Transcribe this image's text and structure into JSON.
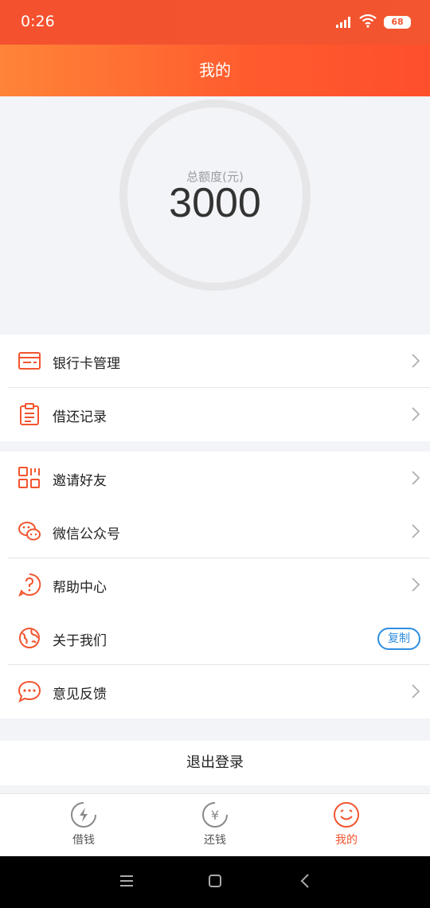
{
  "status": {
    "time": "0:26",
    "battery": "68"
  },
  "header": {
    "title": "我的"
  },
  "credit": {
    "label": "总额度(元)",
    "amount": "3000"
  },
  "menu_group1": [
    {
      "label": "银行卡管理",
      "icon": "bank-card-icon"
    },
    {
      "label": "借还记录",
      "icon": "clipboard-icon"
    }
  ],
  "menu_group2": [
    {
      "label": "邀请好友",
      "icon": "qrcode-icon"
    },
    {
      "label": "微信公众号",
      "icon": "wechat-icon"
    },
    {
      "label": "帮助中心",
      "icon": "help-icon"
    },
    {
      "label": "关于我们",
      "icon": "globe-icon",
      "action": "复制"
    },
    {
      "label": "意见反馈",
      "icon": "chat-icon"
    }
  ],
  "logout": {
    "label": "退出登录"
  },
  "tabs": [
    {
      "label": "借钱",
      "icon": "lightning-icon"
    },
    {
      "label": "还钱",
      "icon": "yen-icon"
    },
    {
      "label": "我的",
      "icon": "smile-icon",
      "active": true
    }
  ],
  "colors": {
    "accent": "#f2552f",
    "header_start": "#ff8437",
    "header_end": "#fe4f2c",
    "link_blue": "#2f8ee0"
  }
}
